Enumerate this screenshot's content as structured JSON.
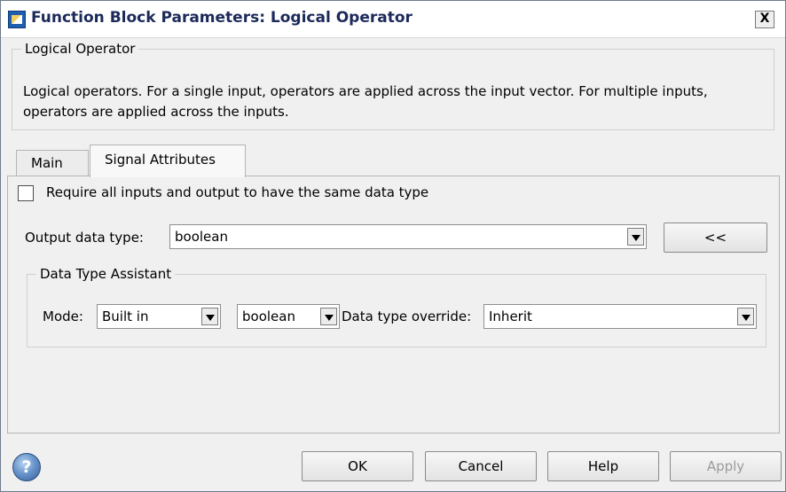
{
  "window": {
    "title": "Function Block Parameters: Logical Operator",
    "close_glyph": "X"
  },
  "block": {
    "group_title": "Logical Operator",
    "description": "Logical operators.  For a single input, operators are applied across the input vector.  For multiple inputs, operators are applied across the inputs."
  },
  "tabs": [
    {
      "label": "Main",
      "selected": false
    },
    {
      "label": "Signal Attributes",
      "selected": true
    }
  ],
  "signal_attributes": {
    "require_same_type_label": "Require all inputs and output to have the same data type",
    "require_same_type_checked": false,
    "output_data_type_label": "Output data type:",
    "output_data_type_value": "boolean",
    "assistant_toggle_label": "<<",
    "assistant": {
      "group_title": "Data Type Assistant",
      "mode_label": "Mode:",
      "mode_value": "Built in",
      "type_value": "boolean",
      "override_label": "Data type override:",
      "override_value": "Inherit"
    }
  },
  "buttons": {
    "ok": "OK",
    "cancel": "Cancel",
    "help": "Help",
    "apply": "Apply"
  },
  "colors": {
    "title_text": "#1c2a5a",
    "disabled_text": "#9a9a9a"
  },
  "help_icon_glyph": "?"
}
